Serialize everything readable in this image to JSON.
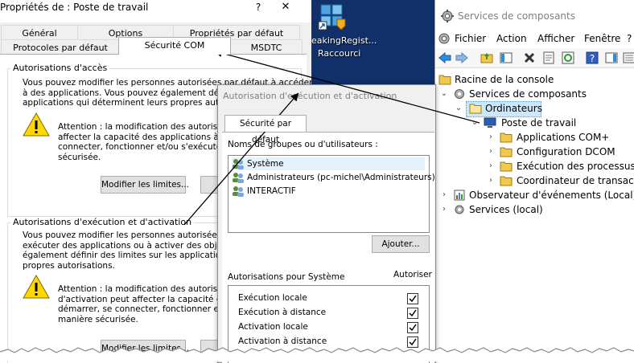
{
  "props_dialog": {
    "title": "Propriétés de : Poste de travail",
    "help_glyph": "?",
    "close_glyph": "✕",
    "tabs_row1": [
      "Général",
      "Options",
      "Propriétés par défaut"
    ],
    "tabs_row2": [
      "Protocoles par défaut",
      "Sécurité COM",
      "MSDTC"
    ],
    "access_group": {
      "legend": "Autorisations d'accès",
      "text": "Vous pouvez modifier les personnes autorisées par défaut à accéder\nà des applications. Vous pouvez également définir\napplications qui déterminent leurs propres autorisati",
      "warning": "Attention : la modification des autorisations\naffecter la capacité des applications à dém\nconnecter, fonctionner et/ou s'exécuter d\nsécurisée.",
      "button": "Modifier les limites..."
    },
    "launch_group": {
      "legend": "Autorisations d'exécution et d'activation",
      "text": "Vous pouvez modifier les personnes autorisées par défaut\nexécuter des applications ou à activer des objets. V\négalement définir des limites sur les applications qui\npropres autorisations.",
      "warning": "Attention : la modification des autorisations\nd'activation peut affecter la capacité des a\ndémarrer, se connecter, fonctionner et/ou\nmanière sécurisée.",
      "button": "Modifier les limites..."
    }
  },
  "desktop": {
    "shortcut_label_1": "eakingRegist...",
    "shortcut_label_2": "Raccourci"
  },
  "perm_dialog": {
    "title": "Autorisation d'exécution et d'activation",
    "tab": "Sécurité par défaut",
    "users_label": "Noms de groupes ou d'utilisateurs :",
    "users": [
      "Système",
      "Administrateurs (pc-michel\\Administrateurs)",
      "INTERACTIF"
    ],
    "add_button": "Ajouter...",
    "perms_label": "Autorisations pour Système",
    "allow_header": "Autoriser",
    "permissions": [
      {
        "label": "Exécution locale",
        "allowed": true
      },
      {
        "label": "Exécution à distance",
        "allowed": true
      },
      {
        "label": "Activation locale",
        "allowed": true
      },
      {
        "label": "Activation à distance",
        "allowed": true
      }
    ]
  },
  "comp_window": {
    "title": "Services de composants",
    "menus": [
      "Fichier",
      "Action",
      "Afficher",
      "Fenêtre",
      "?"
    ],
    "tree": {
      "root": "Racine de la console",
      "services": "Services de composants",
      "computers": "Ordinateurs",
      "my_computer": "Poste de travail",
      "children": [
        "Applications COM+",
        "Configuration DCOM",
        "Exécution des processus",
        "Coordinateur de transactions"
      ],
      "event_viewer": "Observateur d'événements (Local)",
      "services_local": "Services (local)"
    }
  },
  "icons": {
    "warning": "warning-icon",
    "folder": "folder-icon",
    "user": "user-group-icon",
    "computer": "computer-icon"
  },
  "colors": {
    "desktop": "#11306a",
    "selection": "#cce8ff",
    "warning": "#ffd800",
    "folder": "#f2c94c"
  }
}
